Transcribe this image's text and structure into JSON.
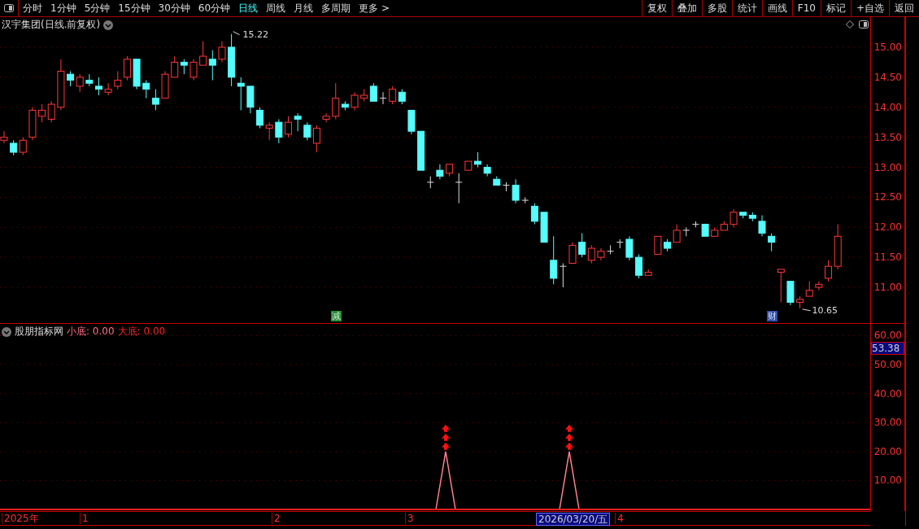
{
  "toolbar": {
    "periods": [
      {
        "label": "分时",
        "selected": false
      },
      {
        "label": "1分钟",
        "selected": false
      },
      {
        "label": "5分钟",
        "selected": false
      },
      {
        "label": "15分钟",
        "selected": false
      },
      {
        "label": "30分钟",
        "selected": false
      },
      {
        "label": "60分钟",
        "selected": false
      },
      {
        "label": "日线",
        "selected": true
      },
      {
        "label": "周线",
        "selected": false
      },
      {
        "label": "月线",
        "selected": false
      },
      {
        "label": "多周期",
        "selected": false
      },
      {
        "label": "更多 >",
        "selected": false
      }
    ],
    "buttons": [
      "复权",
      "叠加",
      "多股",
      "统计",
      "画线",
      "F10",
      "标记",
      "+自选",
      "返回"
    ]
  },
  "price_panel": {
    "title": "汉宇集团(日线.前复权)",
    "high_label": "15.22",
    "low_label": "10.65",
    "markers": [
      {
        "text": "减",
        "color": "#1f8f2f"
      },
      {
        "text": "财",
        "color": "#2a4fb0"
      }
    ],
    "axis_ticks": [
      "15.00",
      "14.50",
      "14.00",
      "13.50",
      "13.00",
      "12.50",
      "12.00",
      "11.50",
      "11.00"
    ]
  },
  "indicator_panel": {
    "name": "股朋指标网",
    "values": [
      {
        "label": "小底: 0.00",
        "color": "#ff7088"
      },
      {
        "label": "大底: 0.00",
        "color": "#ff2020"
      }
    ],
    "current_value": "53.38",
    "axis_ticks": [
      "60.00",
      "50.00",
      "40.00",
      "30.00",
      "20.00",
      "10.00"
    ]
  },
  "date_axis": {
    "labels": [
      {
        "text": "2025年",
        "selected": false
      },
      {
        "text": "1",
        "selected": false
      },
      {
        "text": "2",
        "selected": false
      },
      {
        "text": "3",
        "selected": false
      },
      {
        "text": "2026/03/20/五",
        "selected": true
      },
      {
        "text": "4",
        "selected": false
      }
    ]
  }
}
